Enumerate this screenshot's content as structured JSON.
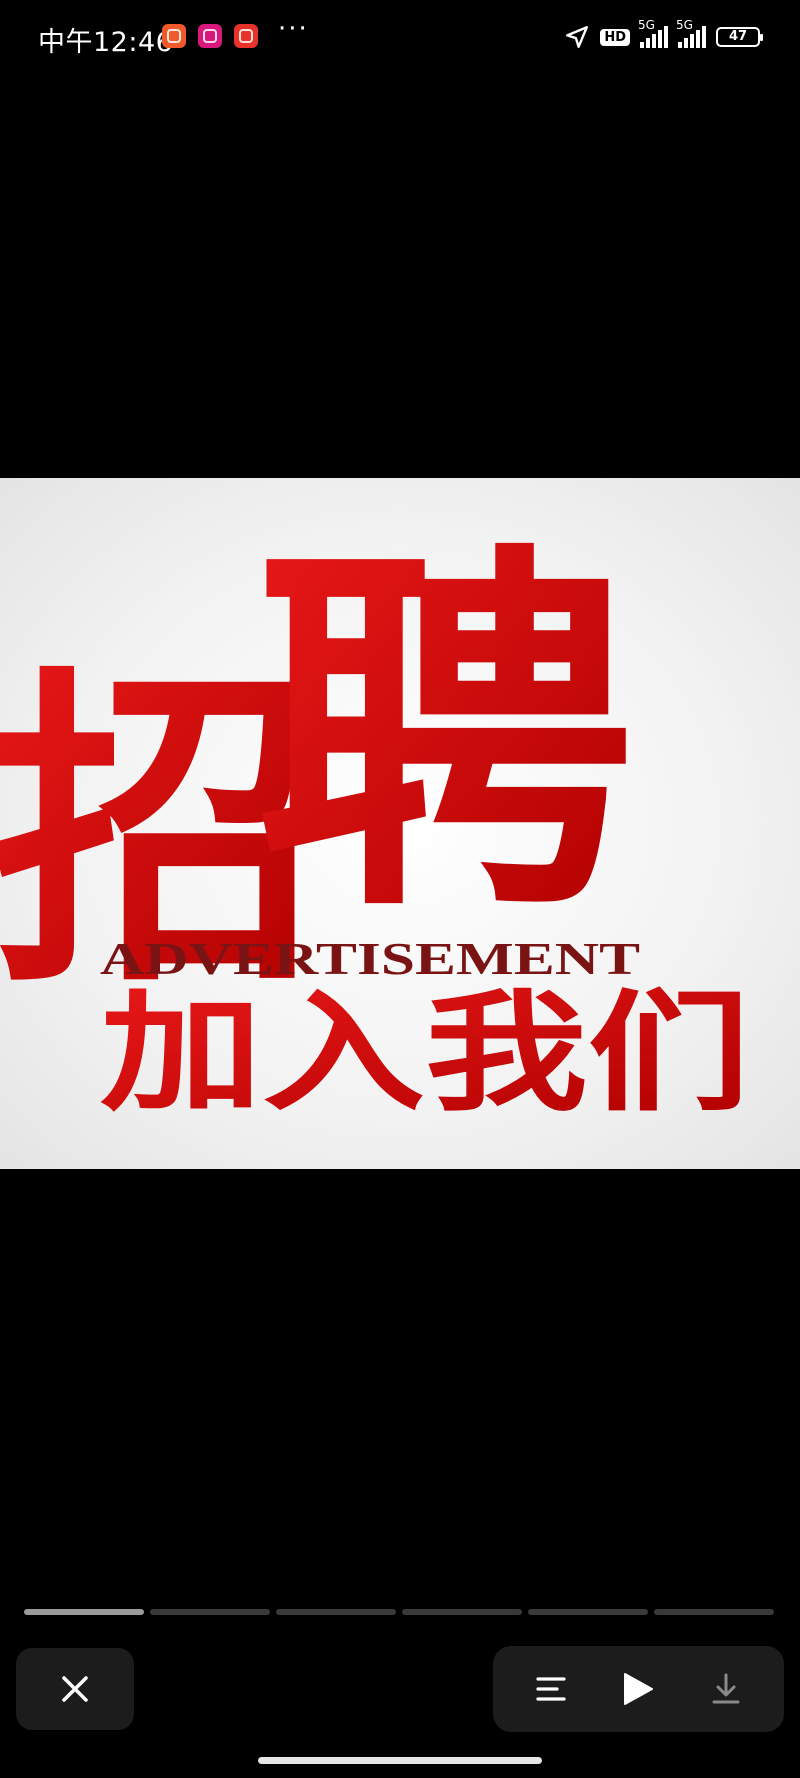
{
  "status_bar": {
    "time": "中午12:46",
    "hd_label": "HD",
    "signal1_label": "5G",
    "signal2_label": "5G",
    "battery": "47",
    "more": "···"
  },
  "poster": {
    "title_left": "招",
    "title_right": "聘",
    "subtitle_en": "ADVERTISEMENT",
    "subtitle_cn": "加入我们"
  },
  "progress": {
    "segments": 6,
    "active_index": 0
  },
  "colors": {
    "poster_red": "#d10a0a",
    "control_bg": "#1c1c1c"
  },
  "controls": {
    "close_icon": "close-icon",
    "list_icon": "list-icon",
    "play_icon": "play-icon",
    "download_icon": "download-icon"
  }
}
